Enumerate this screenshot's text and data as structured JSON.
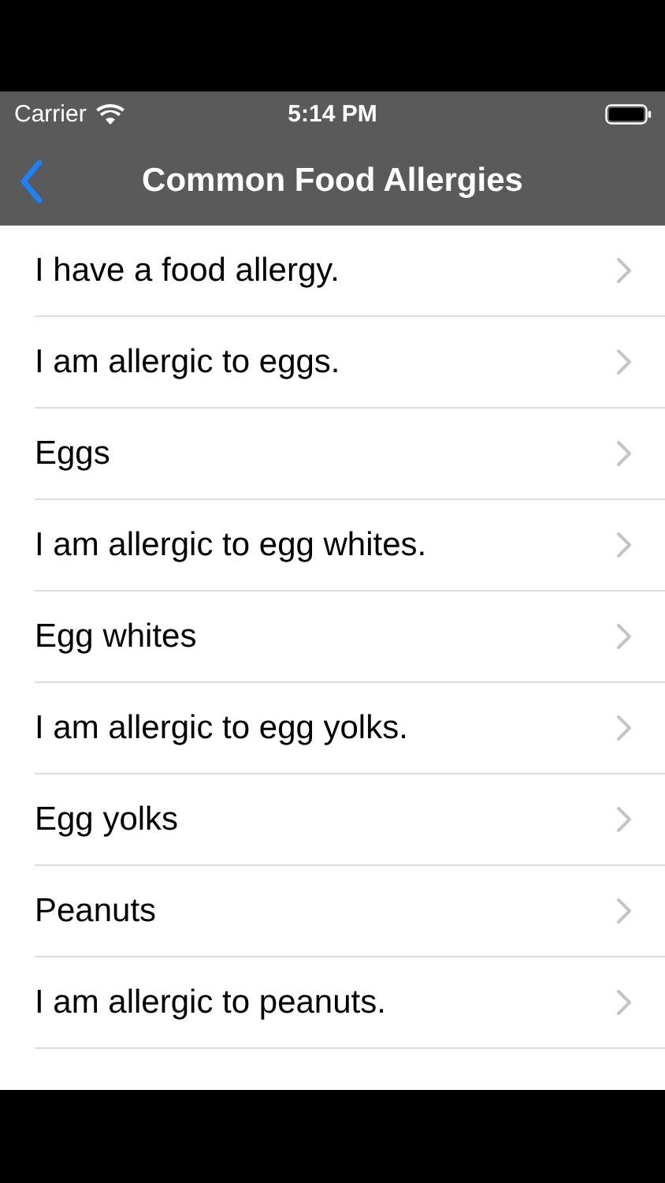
{
  "status_bar": {
    "carrier": "Carrier",
    "time": "5:14 PM"
  },
  "nav_bar": {
    "title": "Common Food Allergies"
  },
  "rows": [
    {
      "label": "I have a food allergy."
    },
    {
      "label": "I am allergic to eggs."
    },
    {
      "label": "Eggs"
    },
    {
      "label": "I am allergic to egg whites."
    },
    {
      "label": "Egg whites"
    },
    {
      "label": "I am allergic to egg yolks."
    },
    {
      "label": "Egg yolks"
    },
    {
      "label": "Peanuts"
    },
    {
      "label": "I am allergic to peanuts."
    }
  ]
}
